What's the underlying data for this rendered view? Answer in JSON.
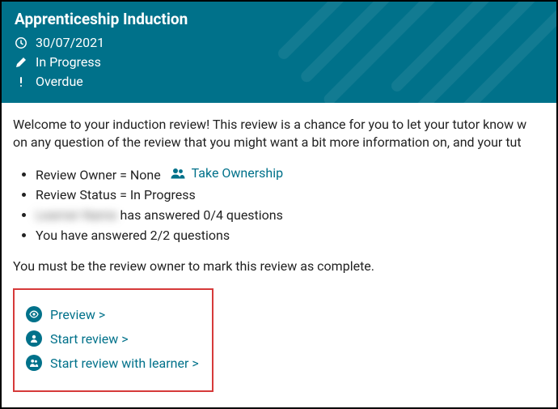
{
  "header": {
    "title": "Apprenticeship Induction",
    "date": "30/07/2021",
    "status": "In Progress",
    "overdue": "Overdue"
  },
  "intro": {
    "line1": "Welcome to your induction review! This review is a chance for you to let your tutor know w",
    "line2": "on any question of the review that you might want a bit more information on, and your tut"
  },
  "status": {
    "owner_label": "Review Owner = ",
    "owner_value": "None",
    "take_ownership": "Take Ownership",
    "review_status_label": "Review Status = ",
    "review_status_value": "In Progress",
    "learner_name_blurred": "Learner Name",
    "learner_answered": " has answered 0/4 questions",
    "you_answered": "You have answered 2/2 questions"
  },
  "note": "You must be the review owner to mark this review as complete.",
  "actions": {
    "preview": "Preview >",
    "start_review": "Start review >",
    "start_with_learner": "Start review with learner >"
  }
}
